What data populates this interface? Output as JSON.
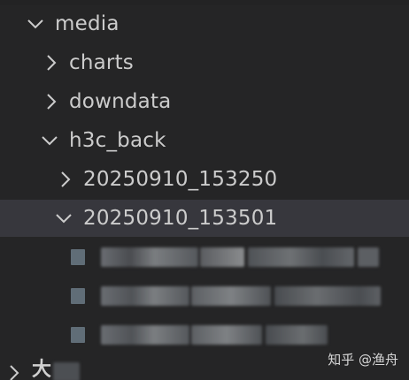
{
  "explorer": {
    "items": [
      {
        "label": "media",
        "expanded": true
      },
      {
        "label": "charts",
        "expanded": false
      },
      {
        "label": "downdata",
        "expanded": false
      },
      {
        "label": "h3c_back",
        "expanded": true
      },
      {
        "label": "20250910_153250",
        "expanded": false
      },
      {
        "label": "20250910_153501",
        "expanded": true
      }
    ],
    "bottom_item": {
      "label": "大"
    }
  },
  "watermark": "知乎 @渔舟",
  "colors": {
    "background": "#252526",
    "selected_row": "#37373d",
    "text": "#cccccc"
  }
}
